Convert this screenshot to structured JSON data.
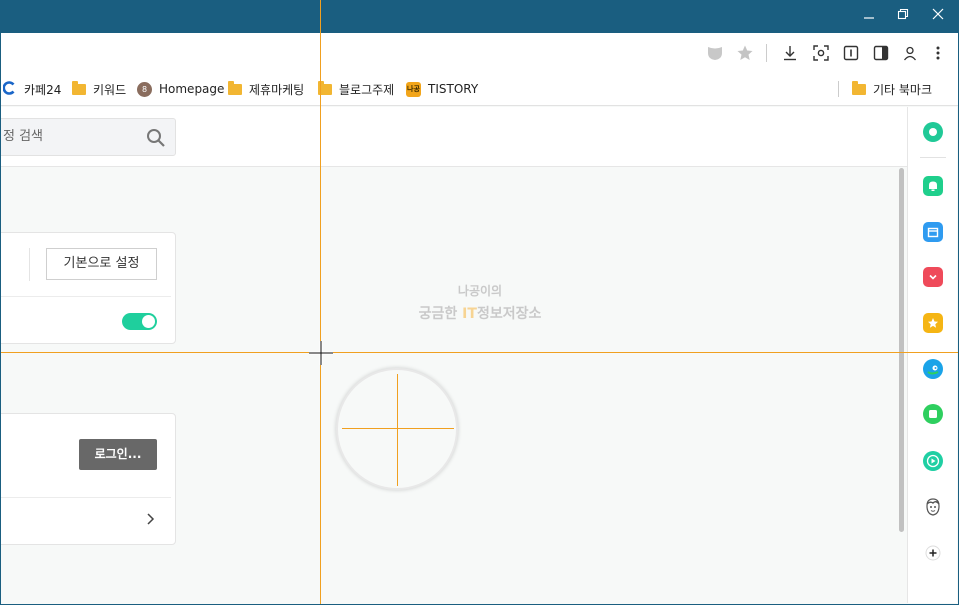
{
  "window": {
    "minimize_icon": "minimize-icon",
    "restore_icon": "restore-icon",
    "close_icon": "close-icon",
    "titlebar_color": "#1a5e80"
  },
  "toolbar": {
    "icons": [
      "shield-icon",
      "star-icon",
      "download-icon",
      "capture-icon",
      "reader-icon",
      "sidepanel-icon",
      "profile-icon",
      "more-icon"
    ]
  },
  "bookmarks": {
    "items": [
      {
        "label": "카페24",
        "icon": "cafe24-icon"
      },
      {
        "label": "키워드",
        "icon": "folder-icon"
      },
      {
        "label": "Homepage",
        "icon": "homepage-icon",
        "badge": "8"
      },
      {
        "label": "제휴마케팅",
        "icon": "folder-icon"
      },
      {
        "label": "블로그주제",
        "icon": "folder-icon"
      },
      {
        "label": "TISTORY",
        "icon": "tistory-icon",
        "badge": "나공"
      }
    ],
    "other": {
      "label": "기타 북마크",
      "icon": "folder-icon"
    }
  },
  "search": {
    "placeholder": "정 검색"
  },
  "settings_card": {
    "default_button": "기본으로 설정",
    "toggle_on": true
  },
  "login_card": {
    "login_button": "로그인..."
  },
  "watermark": {
    "line1": "나공이의",
    "line2_before": "궁금한 ",
    "line2_highlight": "IT",
    "line2_after": "정보저장소"
  },
  "sidebar": {
    "items": [
      {
        "icon": "circle-app-icon",
        "color": "#20c997"
      },
      {
        "icon": "bell-icon",
        "color": "#1fcf8c"
      },
      {
        "icon": "calendar-icon",
        "color": "#2f9bf0"
      },
      {
        "icon": "pocket-icon",
        "color": "#ef4a5a"
      },
      {
        "icon": "star-badge-icon",
        "color": "#f5b514"
      },
      {
        "icon": "bird-icon",
        "color": "#1aa3e8"
      },
      {
        "icon": "square-app-icon",
        "color": "#2ecf5f"
      },
      {
        "icon": "play-icon",
        "color": "#1fcfa3"
      },
      {
        "icon": "face-icon",
        "color": "#555555"
      },
      {
        "icon": "add-icon",
        "color": "#333333"
      }
    ]
  },
  "guides": {
    "color": "#f0a020"
  }
}
